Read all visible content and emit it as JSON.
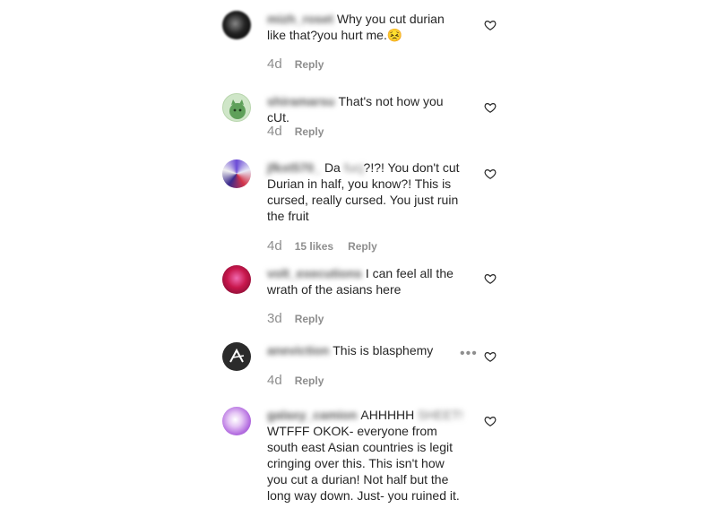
{
  "comments": [
    {
      "username": "mizh_roset",
      "text": "Why you cut durian like that?you hurt me.😣",
      "time": "4d",
      "reply_label": "Reply"
    },
    {
      "username": "shiramarsu",
      "text": "That's not how you cUt.",
      "time": "4d",
      "reply_label": "Reply"
    },
    {
      "username": "jfkxt570_",
      "text_pre": "Da ",
      "blurred_word": "fucj",
      "text": "?!?! You don't cut Durian in half, you know?! This is cursed, really cursed. You just ruin the fruit",
      "time": "4d",
      "likes": "15 likes",
      "reply_label": "Reply"
    },
    {
      "username": "volt_executions",
      "text": "I can feel all the wrath of the asians here",
      "time": "3d",
      "reply_label": "Reply"
    },
    {
      "username": "aneviction",
      "text": "This is blasphemy",
      "time": "4d",
      "more_label": "•••",
      "reply_label": "Reply"
    },
    {
      "username": "galaxy_camion",
      "text_pre": "AHHHHH ",
      "blurred_word": "SHEET!",
      "text": "WTFFF OKOK- everyone from south east Asian countries is legit cringing over this. This isn't how you cut a durian! Not half but the long way down. Just- you ruined it."
    }
  ],
  "icons": {
    "heart": "heart-outline-icon",
    "more": "more-options-icon"
  },
  "colors": {
    "text": "#262626",
    "secondary": "#8e8e8e"
  }
}
